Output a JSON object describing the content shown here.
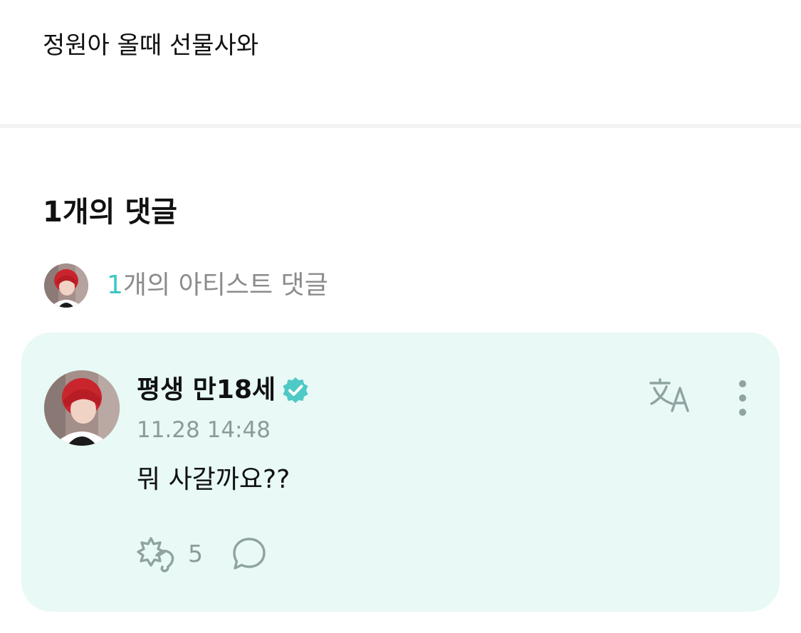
{
  "post": {
    "body": "정원아 올때 선물사와"
  },
  "comments_section": {
    "count_label": "1개의 댓글",
    "artist_summary": {
      "count": "1",
      "label": "개의 아티스트 댓글"
    }
  },
  "comment": {
    "author": "평생 만18세",
    "verified": true,
    "timestamp": "11.28 14:48",
    "text": "뭐 사갈까요??",
    "like_count": "5",
    "icons": {
      "verified": "verified-badge-icon",
      "translate": "translate-icon",
      "more": "more-vertical-icon",
      "like": "like-icon",
      "reply": "reply-bubble-icon"
    }
  },
  "colors": {
    "accent": "#3cc7c6",
    "card_background": "#e8f9f6",
    "muted_text": "#8e9a98",
    "icon_gray": "#8fa3a0"
  }
}
